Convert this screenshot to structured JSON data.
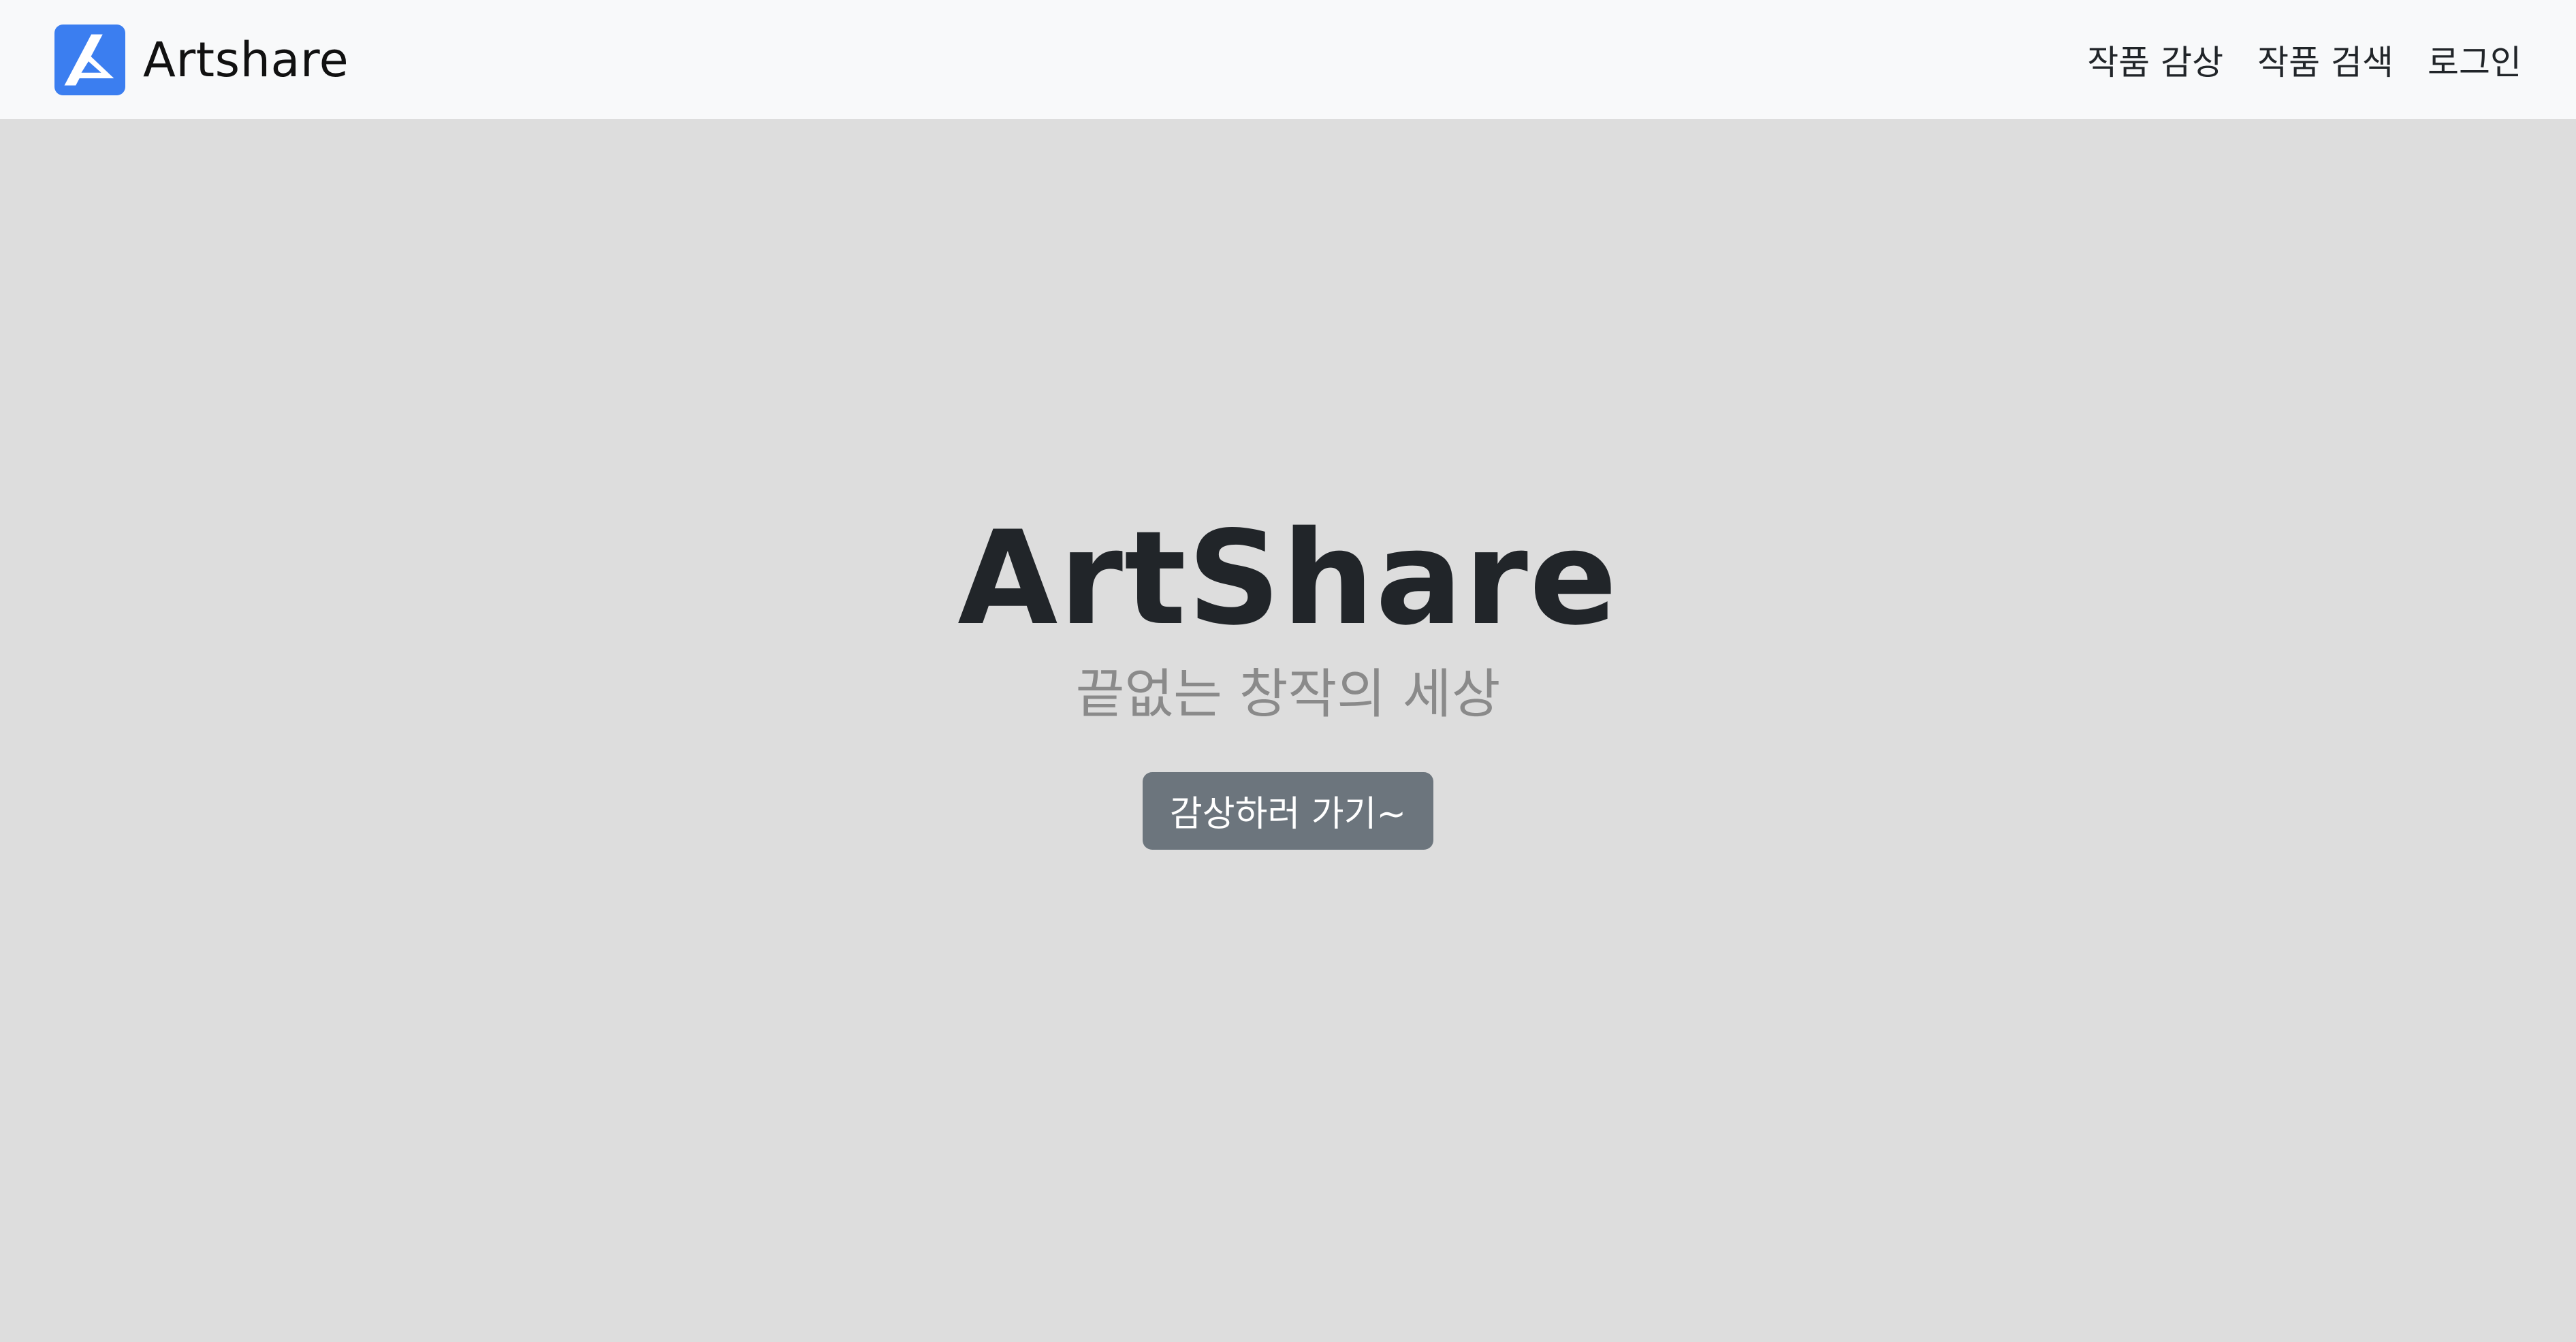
{
  "navbar": {
    "brand_name": "Artshare",
    "logo_icon": "artshare-logo-icon",
    "brand_color": "#3b7ef0",
    "links": [
      {
        "label": "작품 감상"
      },
      {
        "label": "작품 검색"
      },
      {
        "label": "로그인"
      }
    ]
  },
  "hero": {
    "title": "ArtShare",
    "subtitle": "끝없는 창작의 세상",
    "button_label": "감상하러 가기~"
  },
  "colors": {
    "navbar_bg": "#f8f9fa",
    "page_bg": "#dddddd",
    "title_color": "#212529",
    "subtitle_color": "#8a8a8a",
    "button_bg": "#6c757d",
    "button_text": "#ffffff"
  }
}
